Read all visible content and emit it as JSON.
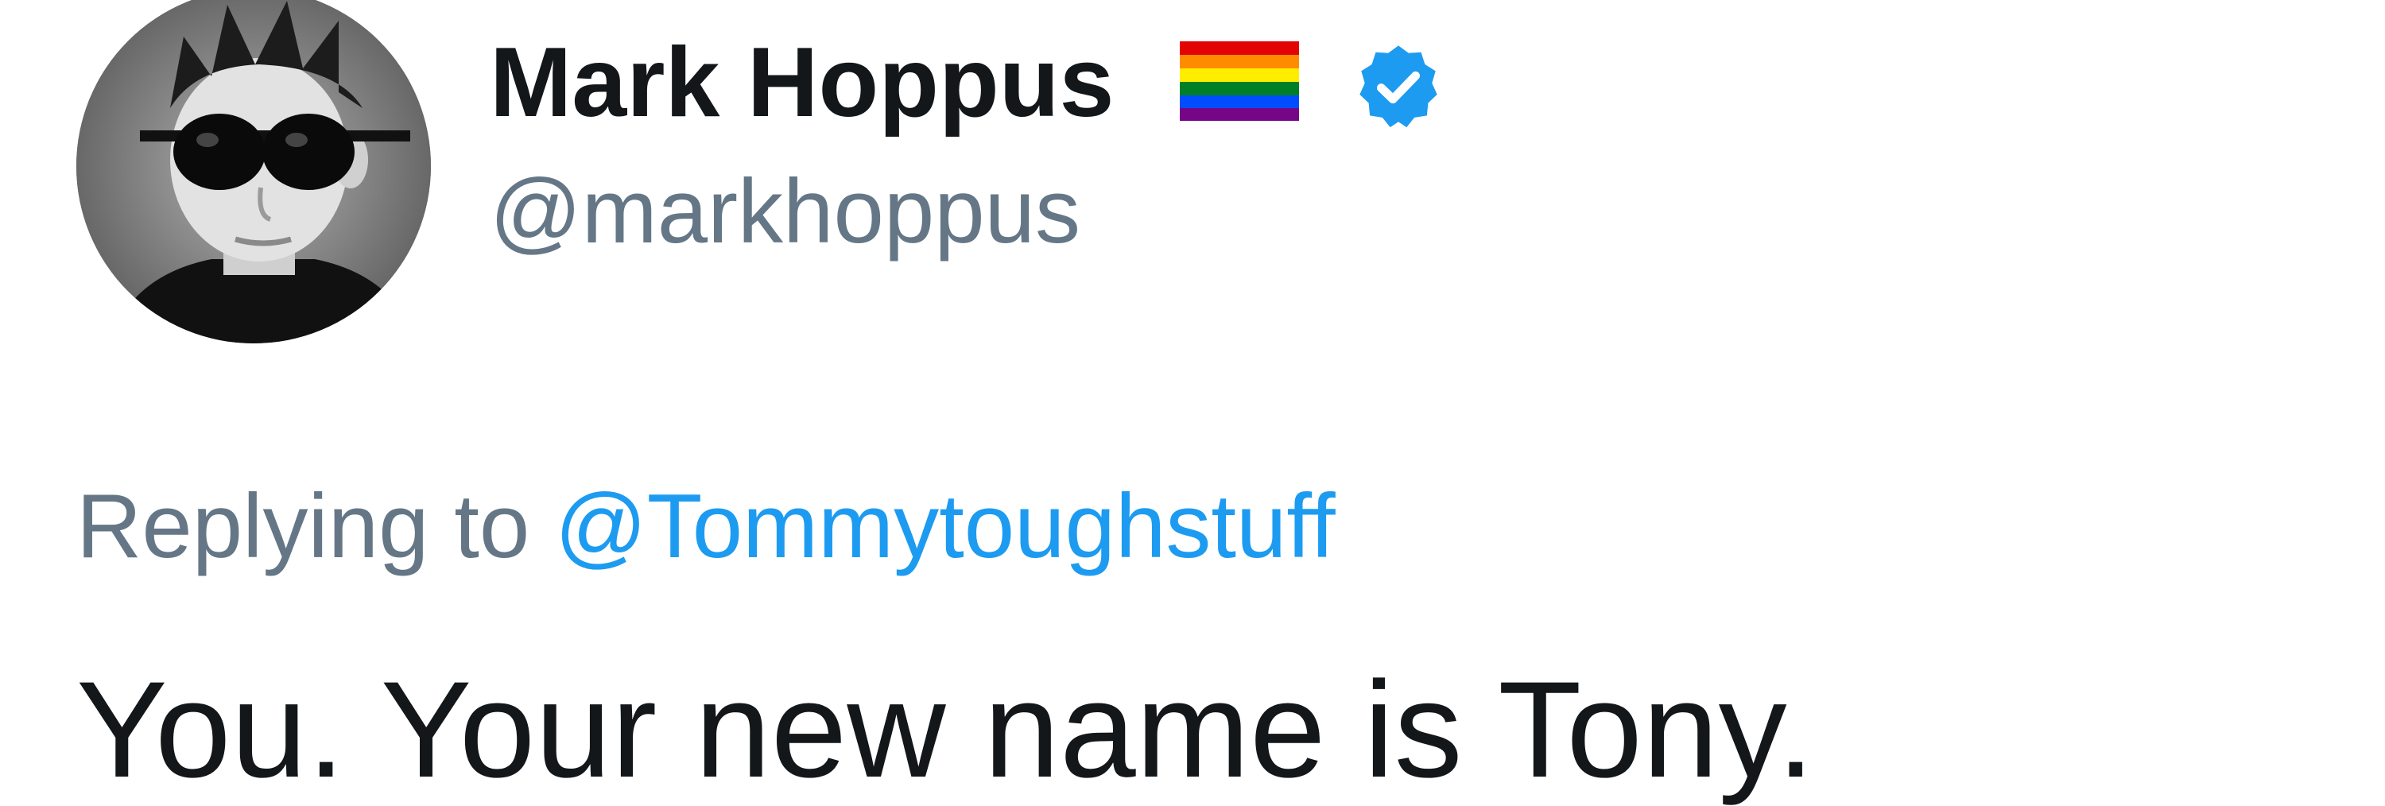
{
  "tweet": {
    "author": {
      "display_name": "Mark Hoppus",
      "handle": "@markhoppus",
      "flag_icon": "rainbow-flag-icon",
      "verified_icon": "verified-badge-icon"
    },
    "reply": {
      "prefix": "Replying to",
      "mention": "@Tommytoughstuff"
    },
    "text": "You. Your new name is Tony."
  },
  "colors": {
    "name": "#14171a",
    "secondary_text": "#657786",
    "link": "#1d9bf0",
    "verified_badge": "#1d9bf0"
  }
}
